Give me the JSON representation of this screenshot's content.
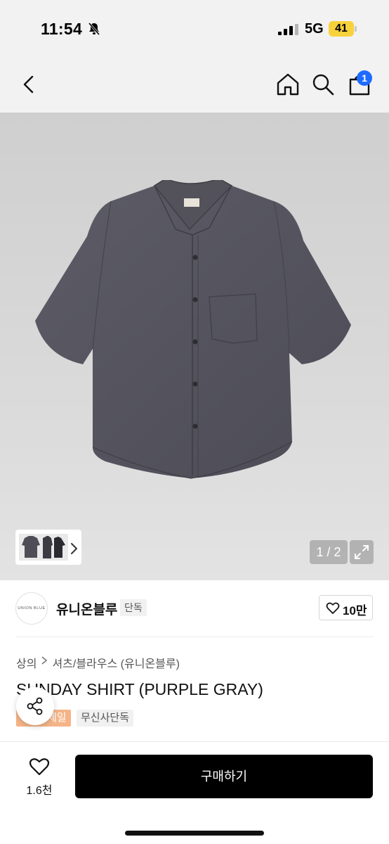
{
  "status_bar": {
    "time": "11:54",
    "network": "5G",
    "battery": "41",
    "icons": [
      "bell-slash-icon",
      "signal-icon"
    ],
    "battery_color": "#f7d23a"
  },
  "header": {
    "icons": [
      "back-icon",
      "home-icon",
      "search-icon",
      "cart-icon"
    ],
    "cart_badge": "1",
    "badge_color": "#1f6bff"
  },
  "gallery": {
    "page_counter": "1 / 2",
    "icons": [
      "chevron-right-icon",
      "expand-icon"
    ]
  },
  "brand": {
    "logo_text": "UNION BLUE",
    "name": "유니온블루",
    "badge": "단독",
    "like_count": "10만"
  },
  "product": {
    "breadcrumb": [
      "상의",
      "셔츠/블라우스 (유니온블루)"
    ],
    "title": "SUNDAY SHIRT (PURPLE GRAY)",
    "tag_sale": "세일",
    "tag_exclusive": "무신사단독",
    "sale_color": "#f5b487"
  },
  "bottom_bar": {
    "wish_count": "1.6천",
    "buy_label": "구매하기"
  }
}
